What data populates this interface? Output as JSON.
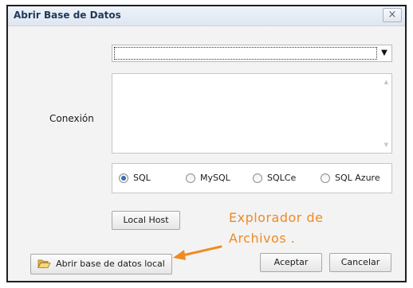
{
  "dialog": {
    "title": "Abrir Base de Datos",
    "close_symbol": "×"
  },
  "connection": {
    "combo_value": "",
    "label": "Conexión",
    "text": ""
  },
  "db_types": {
    "options": [
      "SQL",
      "MySQL",
      "SQLCe",
      "SQL Azure"
    ],
    "selected": "SQL"
  },
  "buttons": {
    "local_host": "Local Host",
    "open_local": "Abrir base de datos local",
    "accept": "Aceptar",
    "cancel": "Cancelar"
  },
  "annotation": {
    "line1": "Explorador de",
    "line2": "Archivos ."
  },
  "colors": {
    "annotation": "#f08a24",
    "title_text": "#1e395b"
  },
  "icons": {
    "open_local": "folder-open-icon",
    "arrow": "arrow-left-icon"
  }
}
